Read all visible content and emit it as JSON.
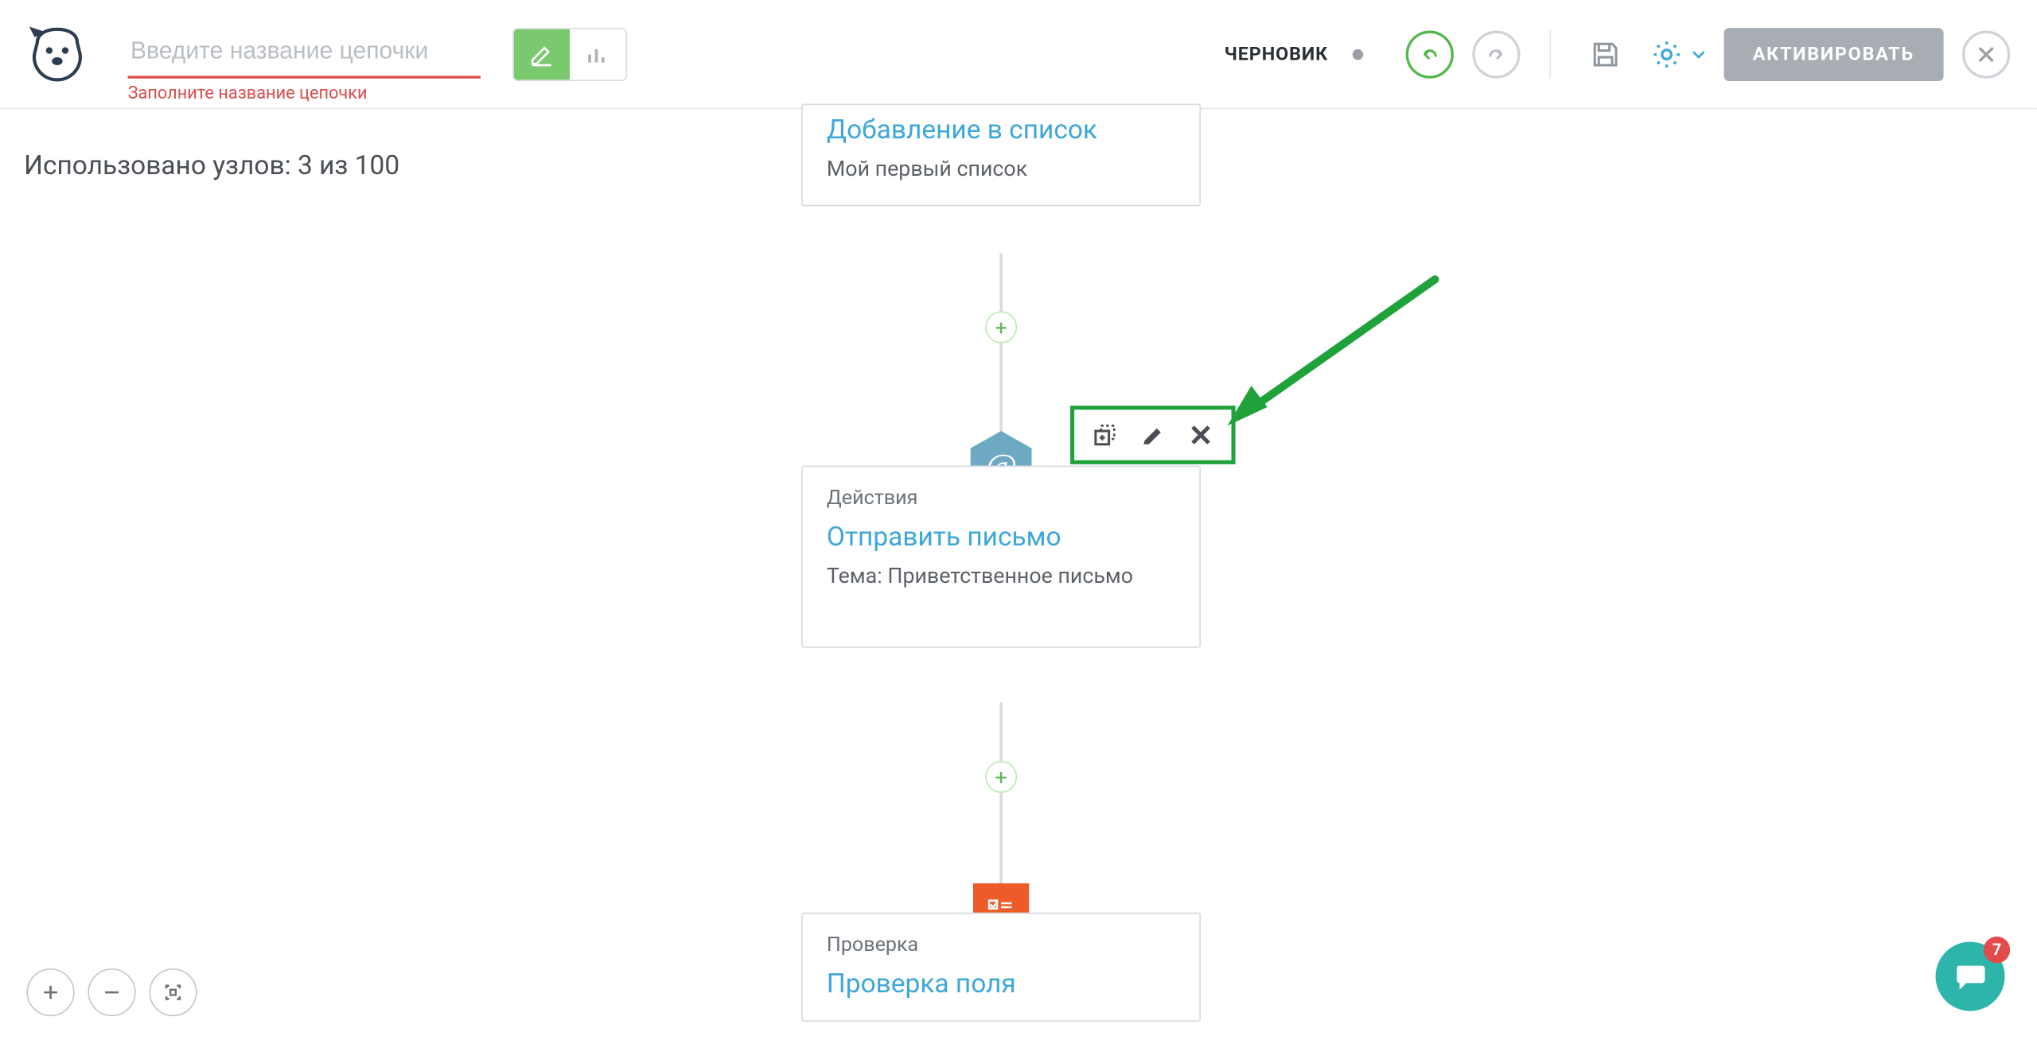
{
  "header": {
    "name_placeholder": "Введите название цепочки",
    "name_error": "Заполните название цепочки",
    "status": "ЧЕРНОВИК",
    "activate_label": "АКТИВИРОВАТЬ"
  },
  "canvas": {
    "nodes_count_text": "Использовано узлов: 3 из 100"
  },
  "nodes": {
    "start": {
      "title": "Добавление в список",
      "subtitle": "Мой первый список"
    },
    "action": {
      "header": "Действия",
      "title": "Отправить письмо",
      "subtitle": "Тема: Приветственное письмо"
    },
    "check": {
      "header": "Проверка",
      "title": "Проверка поля"
    }
  },
  "chat": {
    "badge_count": "7"
  }
}
